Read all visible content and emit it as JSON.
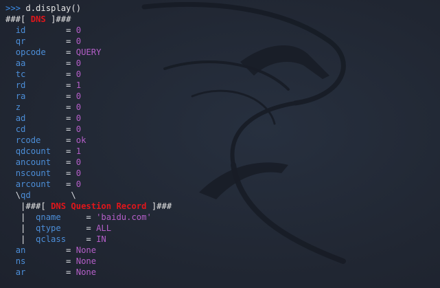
{
  "terminal": {
    "prompt": ">>>",
    "command": "d.display()",
    "dns_layer": {
      "prefix": "###[",
      "name": "DNS",
      "suffix": "]###",
      "fields": [
        {
          "name": "id",
          "eq": "=",
          "value": "0"
        },
        {
          "name": "qr",
          "eq": "=",
          "value": "0"
        },
        {
          "name": "opcode",
          "eq": "=",
          "value": "QUERY"
        },
        {
          "name": "aa",
          "eq": "=",
          "value": "0"
        },
        {
          "name": "tc",
          "eq": "=",
          "value": "0"
        },
        {
          "name": "rd",
          "eq": "=",
          "value": "1"
        },
        {
          "name": "ra",
          "eq": "=",
          "value": "0"
        },
        {
          "name": "z",
          "eq": "=",
          "value": "0"
        },
        {
          "name": "ad",
          "eq": "=",
          "value": "0"
        },
        {
          "name": "cd",
          "eq": "=",
          "value": "0"
        },
        {
          "name": "rcode",
          "eq": "=",
          "value": "ok"
        },
        {
          "name": "qdcount",
          "eq": "=",
          "value": "1"
        },
        {
          "name": "ancount",
          "eq": "=",
          "value": "0"
        },
        {
          "name": "nscount",
          "eq": "=",
          "value": "0"
        },
        {
          "name": "arcount",
          "eq": "=",
          "value": "0"
        }
      ],
      "qd_open": "\\",
      "qd_label": "qd",
      "qd_close": "\\",
      "question": {
        "pipe": "|",
        "prefix": "###[",
        "name": "DNS Question Record",
        "suffix": "]###",
        "fields": [
          {
            "name": "qname",
            "eq": "=",
            "value": "'baidu.com'"
          },
          {
            "name": "qtype",
            "eq": "=",
            "value": "ALL"
          },
          {
            "name": "qclass",
            "eq": "=",
            "value": "IN"
          }
        ]
      },
      "tail_fields": [
        {
          "name": "an",
          "eq": "=",
          "value": "None"
        },
        {
          "name": "ns",
          "eq": "=",
          "value": "None"
        },
        {
          "name": "ar",
          "eq": "=",
          "value": "None"
        }
      ]
    }
  },
  "colors": {
    "background": "#232936",
    "prompt": "#3b8eea",
    "field_name": "#4c8ed8",
    "field_value": "#b55fc9",
    "layer_name": "#e0161b"
  },
  "watermark_icon": "kali-dragon-icon"
}
